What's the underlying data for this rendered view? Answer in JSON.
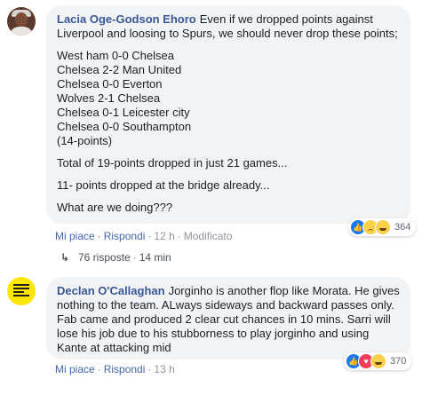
{
  "comment1": {
    "author": "Lacia Oge-Godson Ehoro",
    "intro": "Even if we dropped points against Liverpool and loosing to Spurs, we should never drop these points;",
    "results": [
      "West ham 0-0 Chelsea",
      "Chelsea 2-2 Man United",
      "Chelsea 0-0 Everton",
      "Wolves 2-1 Chelsea",
      "Chelsea 0-1 Leicester city",
      "Chelsea 0-0 Southampton",
      "(14-points)"
    ],
    "total": "Total of 19-points dropped in just 21 games...",
    "bridge": "11- points dropped at the bridge already...",
    "question": "What are we doing???",
    "actions": {
      "like": "Mi piace",
      "reply": "Rispondi",
      "time": "12 h",
      "edited": "Modificato"
    },
    "reactions": {
      "icons": [
        "like-icon",
        "sad-icon",
        "haha-icon"
      ],
      "count": "364"
    },
    "replies": {
      "count": "76 risposte",
      "time": "14 min"
    }
  },
  "comment2": {
    "author": "Declan O'Callaghan",
    "text": "Jorginho is another flop like Morata. He gives nothing to the team. ALways sideways and backward passes only. Fab came and produced 2 clear cut chances in 10 mins. Sarri will lose his job due to his stubborness to play jorginho and using Kante at attacking mid",
    "actions": {
      "like": "Mi piace",
      "reply": "Rispondi",
      "time": "13 h"
    },
    "reactions": {
      "icons": [
        "like-icon",
        "love-icon",
        "haha-icon"
      ],
      "count": "370"
    }
  },
  "colors": {
    "link": "#385898",
    "bubble": "#f2f3f5",
    "action": "#4267b2",
    "muted": "#90949c"
  }
}
